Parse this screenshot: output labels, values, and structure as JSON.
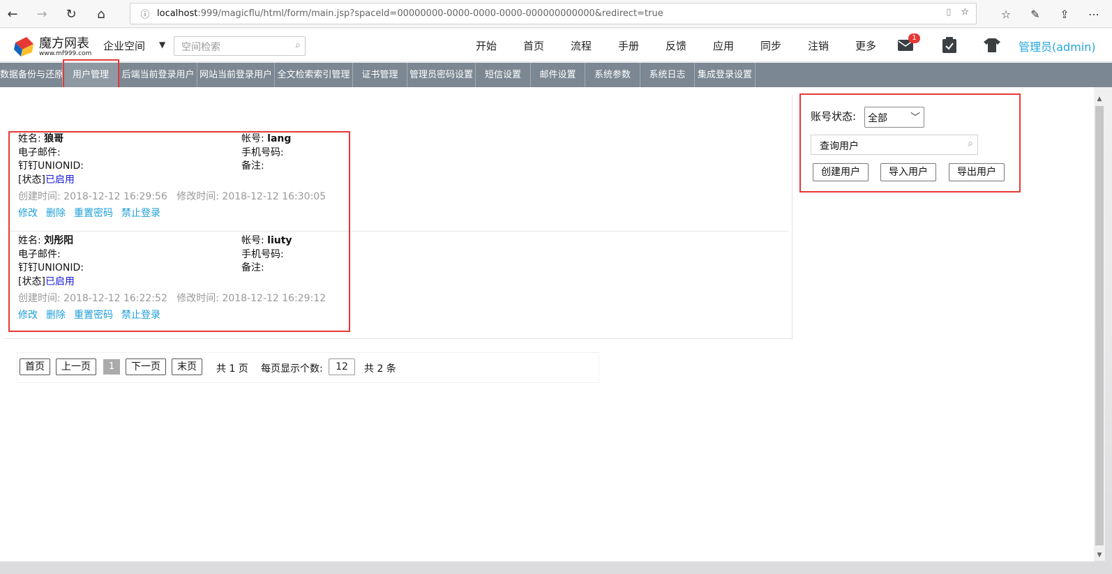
{
  "browser": {
    "url_host": "localhost",
    "url_rest": ":999/magicflu/html/form/main.jsp?spaceId=00000000-0000-0000-0000-000000000000&redirect=true"
  },
  "header": {
    "logo_title": "魔方网表",
    "logo_sub": "www.mf999.com",
    "space_label": "企业空间",
    "space_search_placeholder": "空间检索",
    "nav": [
      "开始",
      "首页",
      "流程",
      "手册",
      "反馈",
      "应用",
      "同步",
      "注销",
      "更多"
    ],
    "mail_badge": "1",
    "admin_label": "管理员(admin)"
  },
  "subnav": {
    "tabs": [
      "数据备份与还原",
      "用户管理",
      "后端当前登录用户",
      "网站当前登录用户",
      "全文检索索引管理",
      "证书管理",
      "管理员密码设置",
      "短信设置",
      "邮件设置",
      "系统参数",
      "系统日志",
      "集成登录设置"
    ],
    "active": "用户管理"
  },
  "labels": {
    "name": "姓名:",
    "account": "帐号:",
    "email": "电子邮件:",
    "phone": "手机号码:",
    "dingtalk": "钉钉UNIONID:",
    "remark": "备注:",
    "status": "[状态]",
    "created": "创建时间:",
    "modified": "修改时间:"
  },
  "ops": [
    "修改",
    "删除",
    "重置密码",
    "禁止登录"
  ],
  "users": [
    {
      "name": "狼哥",
      "account": "lang",
      "status": "已启用",
      "created": "2018-12-12 16:29:56",
      "modified": "2018-12-12 16:30:05"
    },
    {
      "name": "刘彤阳",
      "account": "liuty",
      "status": "已启用",
      "created": "2018-12-12 16:22:52",
      "modified": "2018-12-12 16:29:12"
    }
  ],
  "pager": {
    "first": "首页",
    "prev": "上一页",
    "current": "1",
    "next": "下一页",
    "last": "末页",
    "total_pages": "共 1 页",
    "per_page_label": "每页显示个数:",
    "per_page": "12",
    "total": "共 2 条"
  },
  "filter": {
    "status_label": "账号状态:",
    "status_value": "全部",
    "search_placeholder": "查询用户",
    "buttons": [
      "创建用户",
      "导入用户",
      "导出用户"
    ]
  },
  "colors": {
    "highlight": "#e53935",
    "link": "#1e9fd8",
    "status": "#1a1adb",
    "subnav_bg": "#7b8792",
    "admin": "#22a6dc"
  }
}
